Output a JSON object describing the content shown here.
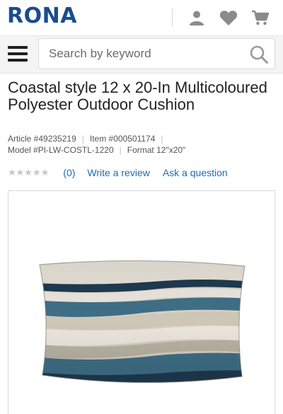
{
  "header": {
    "logo": "RONA",
    "icons": [
      "account-icon",
      "wishlist-heart-icon",
      "cart-icon"
    ]
  },
  "search": {
    "placeholder": "Search by keyword"
  },
  "product": {
    "title": "Coastal style 12 x 20-In Multicoloured Polyester Outdoor Cushion",
    "article": "Article #49235219",
    "item": "Item #000501174",
    "model": "Model #PI-LW-COSTL-1220",
    "format": "Format 12\"x20\"",
    "rating": {
      "stars": "★★★★★",
      "value": 0,
      "count_label": "(0)",
      "write_review": "Write a review",
      "ask_question": "Ask a question"
    }
  },
  "colors": {
    "brand": "#1a4c8f",
    "link": "#1c6cb0",
    "pillow_navy": "#1f3a4f",
    "pillow_teal": "#3f6f86",
    "pillow_beige": "#cfc7b6",
    "pillow_cream": "#e8e4da"
  }
}
